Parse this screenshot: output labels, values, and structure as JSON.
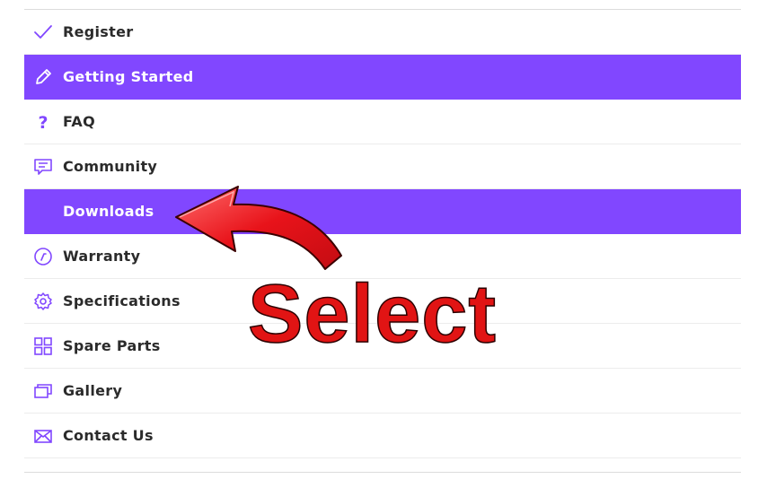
{
  "menu": {
    "items": [
      {
        "label": "Register",
        "icon": "checkmark-icon",
        "active": false
      },
      {
        "label": "Getting Started",
        "icon": "pencil-icon",
        "active": true
      },
      {
        "label": "FAQ",
        "icon": "question-icon",
        "active": false
      },
      {
        "label": "Community",
        "icon": "chat-icon",
        "active": false
      },
      {
        "label": "Downloads",
        "icon": "",
        "active": true
      },
      {
        "label": "Warranty",
        "icon": "warranty-icon",
        "active": false
      },
      {
        "label": "Specifications",
        "icon": "gear-icon",
        "active": false
      },
      {
        "label": "Spare Parts",
        "icon": "grid-icon",
        "active": false
      },
      {
        "label": "Gallery",
        "icon": "gallery-icon",
        "active": false
      },
      {
        "label": "Contact Us",
        "icon": "envelope-icon",
        "active": false
      }
    ]
  },
  "annotation": {
    "text": "Select",
    "color": "#e11414"
  },
  "colors": {
    "accent": "#8147ff",
    "icon": "#8147ff",
    "label": "#2b2b2b",
    "active_label": "#ffffff"
  }
}
